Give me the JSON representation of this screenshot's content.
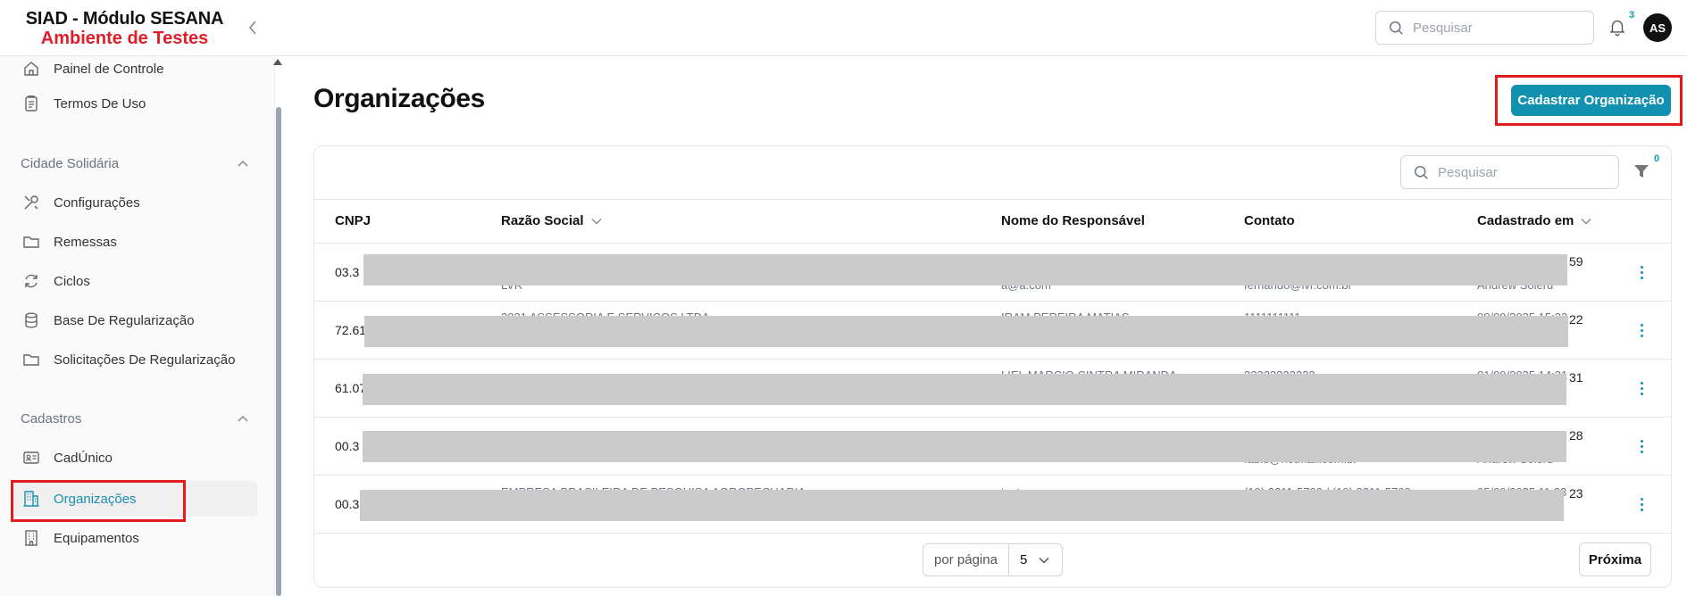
{
  "header": {
    "title": "SIAD - Módulo SESANA",
    "environment": "Ambiente de Testes",
    "search_placeholder": "Pesquisar",
    "notifications_count": "3",
    "avatar_initials": "AS"
  },
  "sidebar": {
    "top_items": [
      {
        "label": "Painel de Controle",
        "icon": "home-icon"
      },
      {
        "label": "Termos De Uso",
        "icon": "clipboard-icon"
      }
    ],
    "sections": [
      {
        "title": "Cidade Solidária",
        "items": [
          {
            "label": "Configurações",
            "icon": "tools-icon"
          },
          {
            "label": "Remessas",
            "icon": "folder-icon"
          },
          {
            "label": "Ciclos",
            "icon": "refresh-icon"
          },
          {
            "label": "Base De Regularização",
            "icon": "database-icon"
          },
          {
            "label": "Solicitações De Regularização",
            "icon": "folder-icon"
          }
        ]
      },
      {
        "title": "Cadastros",
        "items": [
          {
            "label": "CadÚnico",
            "icon": "id-card-icon"
          },
          {
            "label": "Organizações",
            "icon": "building-icon",
            "active": true
          },
          {
            "label": "Equipamentos",
            "icon": "building-outline-icon"
          }
        ]
      }
    ]
  },
  "main": {
    "title": "Organizações",
    "primary_button": "Cadastrar Organização",
    "table_search_placeholder": "Pesquisar",
    "filter_count": "0",
    "columns": [
      "CNPJ",
      "Razão Social",
      "Nome do Responsável",
      "Contato",
      "Cadastrado em"
    ],
    "rows": [
      {
        "cnpj": "03.3",
        "time_tail": "59",
        "faint_razao": "LVR",
        "faint_resp": "a@a.com",
        "faint_contato": "fernando@lvr.com.br",
        "faint_cad": "Andrew Soleru"
      },
      {
        "cnpj": "72.61",
        "time_tail": "22",
        "faint_razao": "2021 ASSESSORIA E SERVICOS LTDA",
        "faint_resp": "IRAM PEREIRA MATIAS",
        "faint_contato": "1111111111",
        "faint_cad": "08/09/2025 15:22"
      },
      {
        "cnpj": "61.07",
        "time_tail": "31",
        "faint_razao": "",
        "faint_resp": "LIEL MARCIO CINTRA MIRANDA",
        "faint_contato": "22222222222",
        "faint_cad": "01/09/2025 14:31"
      },
      {
        "cnpj": "00.3",
        "time_tail": "28",
        "faint_razao": "",
        "faint_resp": "",
        "faint_contato": "fabio@hotmail.com.br",
        "faint_cad": "Andrew Soleru"
      },
      {
        "cnpj": "00.3",
        "time_tail": "23",
        "faint_razao": "EMPRESA BRASILEIRA DE PESQUISA AGROPECUARIA",
        "faint_resp": "teste",
        "faint_contato": "(19) 3211-5700 / (19) 3211-5700",
        "faint_cad": "05/09/2025 11:23"
      }
    ],
    "pagination": {
      "per_page_label": "por página",
      "per_page_value": "5",
      "next_label": "Próxima"
    }
  },
  "colors": {
    "accent": "#1190b0",
    "highlight": "#e41b1b",
    "environment": "#e11d2a",
    "active_text": "#1a8fb1"
  }
}
